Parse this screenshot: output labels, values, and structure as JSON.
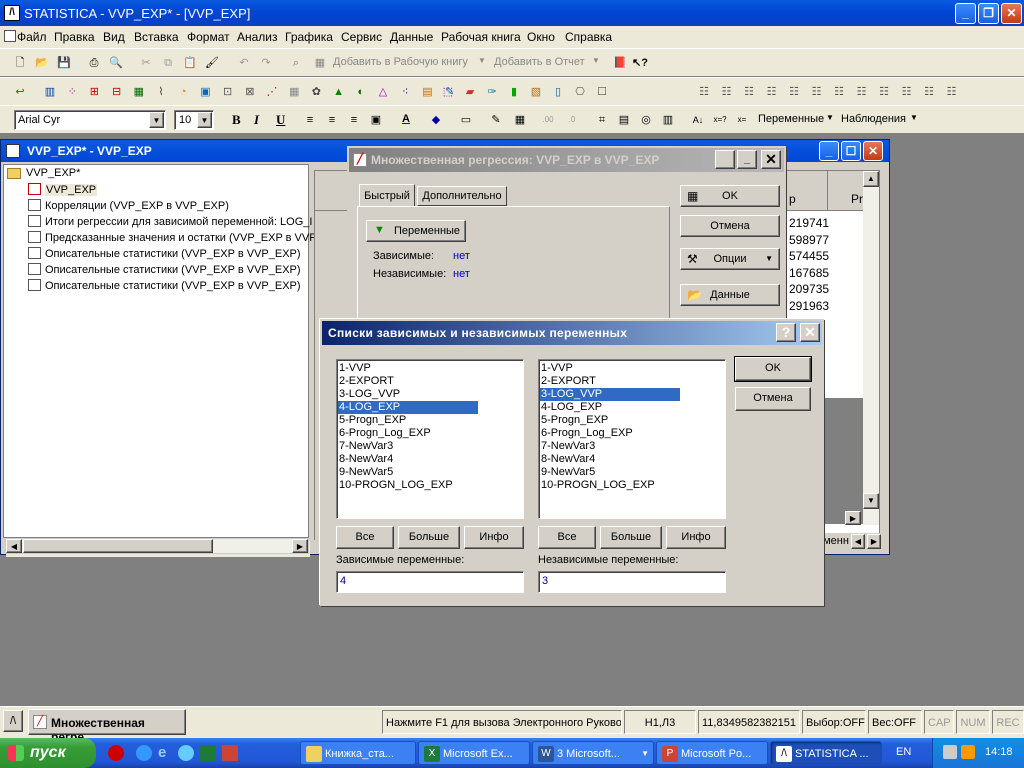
{
  "app": {
    "title": "STATISTICA - VVP_EXP* - [VVP_EXP]"
  },
  "menu": [
    "Файл",
    "Правка",
    "Вид",
    "Вставка",
    "Формат",
    "Анализ",
    "Графика",
    "Сервис",
    "Данные",
    "Рабочая книга",
    "Окно",
    "Справка"
  ],
  "toolbar": {
    "add_workbook": "Добавить в Рабочую книгу",
    "add_report": "Добавить в Отчет",
    "font_name": "Arial Cyr",
    "font_size": "10",
    "bold": "B",
    "italic": "I",
    "underline": "U",
    "variables": "Переменные",
    "cases": "Наблюдения"
  },
  "workbook": {
    "title": "VVP_EXP* - VVP_EXP",
    "root": "VVP_EXP*",
    "items": [
      "VVP_EXP",
      "Корреляции (VVP_EXP в VVP_EXP)",
      "Итоги регрессии для зависимой переменной: LOG_I",
      "Предсказанные значения и остатки (VVP_EXP в VVP",
      "Описательные статистики (VVP_EXP в VVP_EXP)",
      "Описательные статистики (VVP_EXP в VVP_EXP)",
      "Описательные статистики (VVP_EXP в VVP_EXP)"
    ],
    "col_header_p": "р",
    "col_header_pr": "Pr",
    "col_values": [
      "219741",
      "598977",
      "574455",
      "167685",
      "209735",
      "291963"
    ],
    "bottom_tab": "еменн"
  },
  "mr_dialog": {
    "title": "Множественная регрессия: VVP_EXP в VVP_EXP",
    "tabs": [
      "Быстрый",
      "Дополнительно"
    ],
    "vars_button": "Переменные",
    "dep_label": "Зависимые:",
    "dep_value": "нет",
    "indep_label": "Независимые:",
    "indep_value": "нет",
    "ok": "OK",
    "cancel": "Отмена",
    "options": "Опции",
    "data": "Данные",
    "help": "?"
  },
  "var_dialog": {
    "title": "Списки зависимых и независимых переменных",
    "help": "?",
    "variables": [
      "1-VVP",
      "2-EXPORT",
      "3-LOG_VVP",
      "4-LOG_EXP",
      "5-Progn_EXP",
      "6-Progn_Log_EXP",
      "7-NewVar3",
      "8-NewVar4",
      "9-NewVar5",
      "10-PROGN_LOG_EXP"
    ],
    "left_selected": "4-LOG_EXP",
    "right_selected": "3-LOG_VVP",
    "all": "Все",
    "more": "Больше",
    "info": "Инфо",
    "ok": "OK",
    "cancel": "Отмена",
    "dep_label": "Зависимые переменные:",
    "dep_value": "4",
    "indep_label": "Независимые переменные:",
    "indep_value": "3"
  },
  "status": {
    "doc": "Множественная регре...",
    "hint": "Нажмите F1 для вызова Электронного Руково",
    "cell": "H1,Л3",
    "value": "11,8349582382151",
    "sel": "Выбор:OFF",
    "weight": "Вес:OFF",
    "cap": "CAP",
    "num": "NUM",
    "rec": "REC"
  },
  "taskbar": {
    "start": "пуск",
    "tasks": [
      "Книжка_ста...",
      "Microsoft Ex...",
      "3 Microsoft...",
      "Microsoft Po...",
      "STATISTICA ..."
    ],
    "lang": "EN",
    "clock": "14:18"
  }
}
